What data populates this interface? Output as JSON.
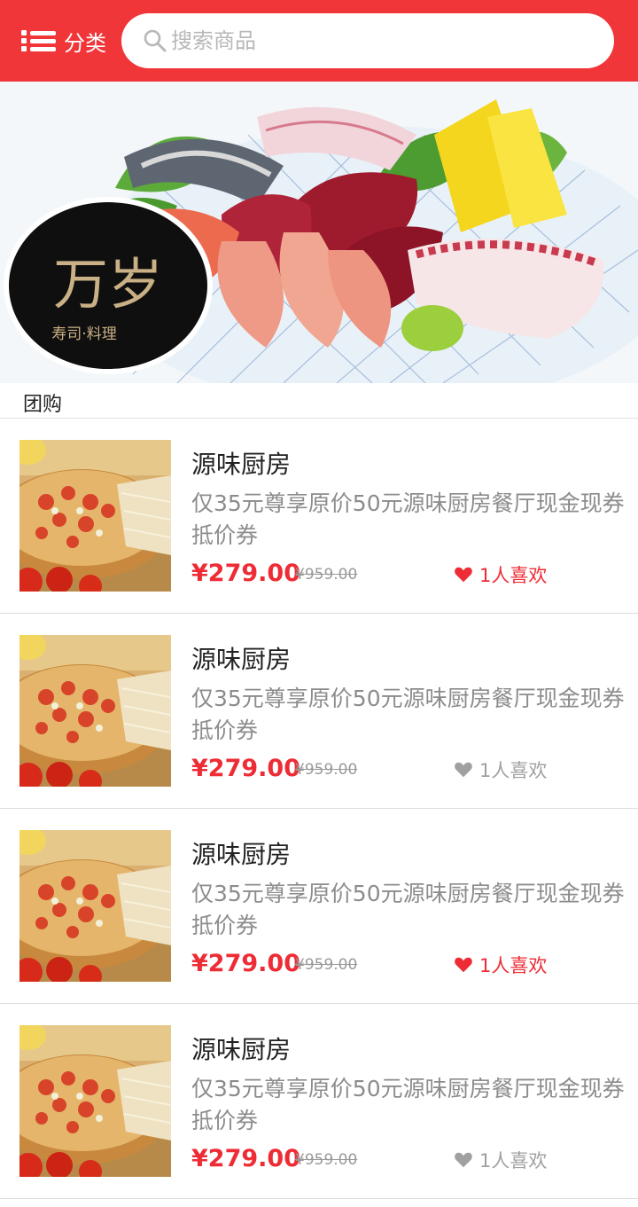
{
  "header": {
    "category_label": "分类",
    "search_placeholder": "搜索商品"
  },
  "banner": {
    "logo_text": "万岁",
    "logo_subtitle": "寿司·料理"
  },
  "section": {
    "title": "团购"
  },
  "products": [
    {
      "title": "源味厨房",
      "desc": "仅35元尊享原价50元源味厨房餐厅现金现券抵价券",
      "price": "¥279.00",
      "old_price": "¥959.00",
      "likes": "1人喜欢",
      "liked": true
    },
    {
      "title": "源味厨房",
      "desc": "仅35元尊享原价50元源味厨房餐厅现金现券抵价券",
      "price": "¥279.00",
      "old_price": "¥959.00",
      "likes": "1人喜欢",
      "liked": false
    },
    {
      "title": "源味厨房",
      "desc": "仅35元尊享原价50元源味厨房餐厅现金现券抵价券",
      "price": "¥279.00",
      "old_price": "¥959.00",
      "likes": "1人喜欢",
      "liked": true
    },
    {
      "title": "源味厨房",
      "desc": "仅35元尊享原价50元源味厨房餐厅现金现券抵价券",
      "price": "¥279.00",
      "old_price": "¥959.00",
      "likes": "1人喜欢",
      "liked": false
    }
  ],
  "colors": {
    "brand_red": "#f1363a",
    "price_red": "#ee2c35",
    "muted_gray": "#a0a0a0"
  }
}
